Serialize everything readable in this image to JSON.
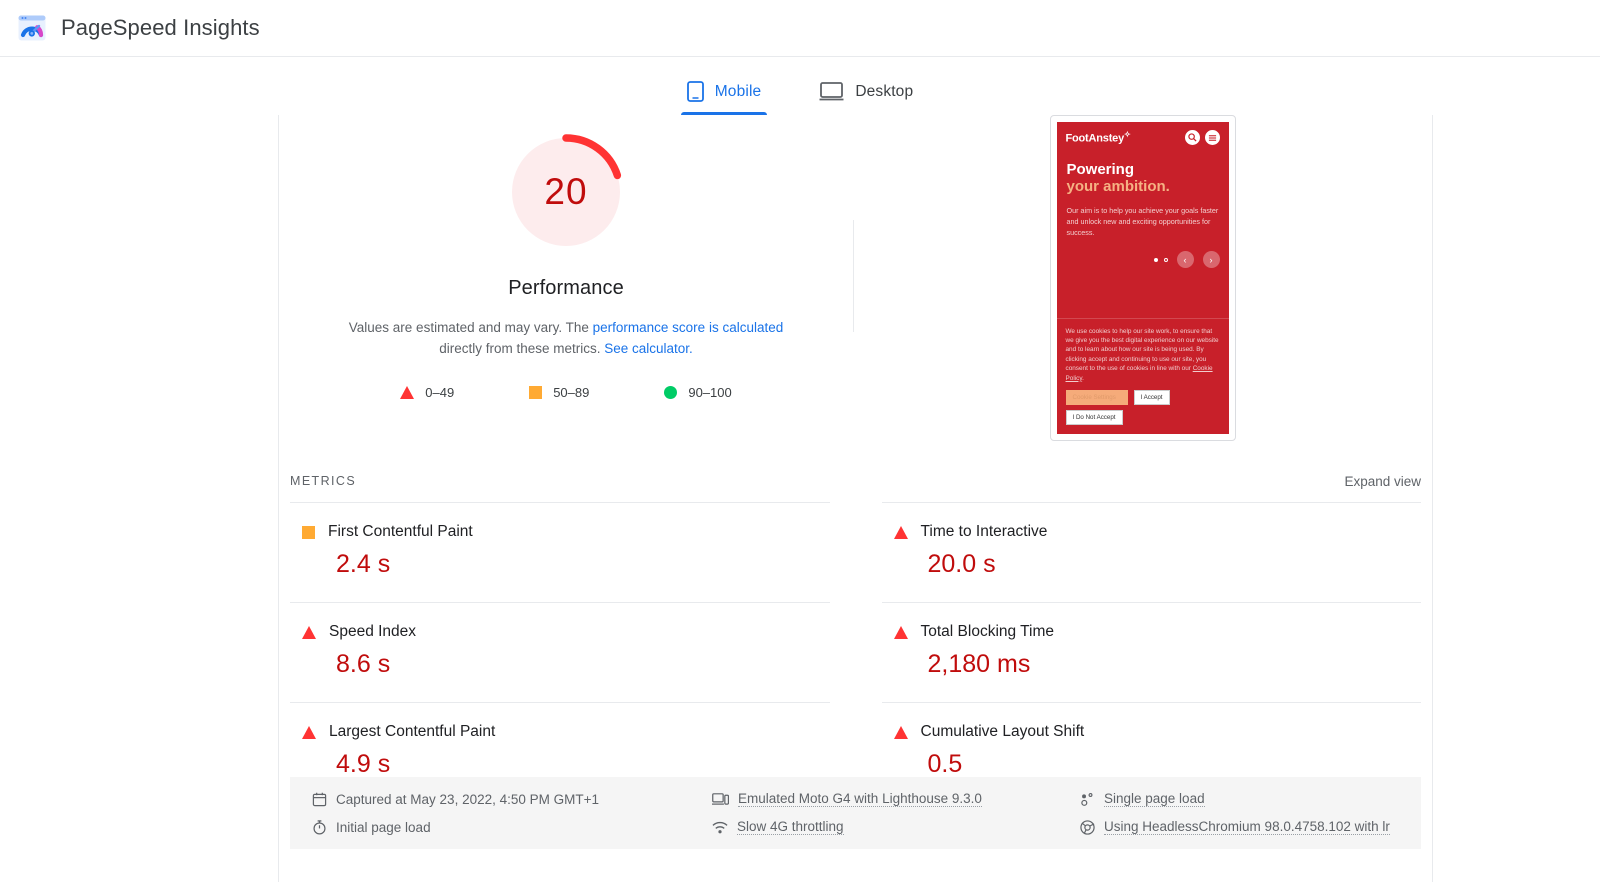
{
  "header": {
    "title": "PageSpeed Insights",
    "logo_icon": "pagespeed-logo-icon"
  },
  "tabs": [
    {
      "label": "Mobile",
      "icon": "mobile-phone-icon",
      "active": true
    },
    {
      "label": "Desktop",
      "icon": "desktop-monitor-icon",
      "active": false
    }
  ],
  "summary": {
    "score": "20",
    "score_color": "#c00c0c",
    "score_track_color": "#fdeced",
    "score_percent": 20,
    "category_title": "Performance",
    "description_part1": "Values are estimated and may vary. The ",
    "description_link1": "performance score is calculated",
    "description_part2": " directly from these metrics. ",
    "description_link2": "See calculator.",
    "legend": [
      {
        "icon": "red-triangle-icon",
        "label": "0–49",
        "color": "#ff3333"
      },
      {
        "icon": "orange-square-icon",
        "label": "50–89",
        "color": "#ffaa33"
      },
      {
        "icon": "green-circle-icon",
        "label": "90–100",
        "color": "#00cc66"
      }
    ]
  },
  "screenshot": {
    "brand": "FootAnstey",
    "brand_mark": "✧",
    "search_icon": "search-icon",
    "menu_icon": "hamburger-menu-icon",
    "heading_line1": "Powering",
    "heading_line2": "your ambition.",
    "body": "Our aim is to help you achieve your goals faster and unlock new and exciting opportunities for success.",
    "prev_arrow": "‹",
    "next_arrow": "›",
    "cookie_text_before_link": "We use cookies to help our site work, to ensure that we give you the best digital experience on our website and to learn about how our site is being used. By clicking accept and continuing to use our site, you consent to the use of cookies in line with our ",
    "cookie_link": "Cookie Policy",
    "cookie_text_after_link": ".",
    "buttons": {
      "settings": "Cookie Settings",
      "accept": "I Accept",
      "decline": "I Do Not Accept"
    }
  },
  "metrics_section": {
    "label": "METRICS",
    "expand_label": "Expand view",
    "items": [
      {
        "name": "First Contentful Paint",
        "value": "2.4 s",
        "status": "average",
        "icon": "orange-square-icon"
      },
      {
        "name": "Time to Interactive",
        "value": "20.0 s",
        "status": "poor",
        "icon": "red-triangle-icon"
      },
      {
        "name": "Speed Index",
        "value": "8.6 s",
        "status": "poor",
        "icon": "red-triangle-icon"
      },
      {
        "name": "Total Blocking Time",
        "value": "2,180 ms",
        "status": "poor",
        "icon": "red-triangle-icon"
      },
      {
        "name": "Largest Contentful Paint",
        "value": "4.9 s",
        "status": "poor",
        "icon": "red-triangle-icon"
      },
      {
        "name": "Cumulative Layout Shift",
        "value": "0.5",
        "status": "poor",
        "icon": "red-triangle-icon"
      }
    ]
  },
  "environment": [
    {
      "icon": "calendar-icon",
      "text": "Captured at May 23, 2022, 4:50 PM GMT+1",
      "dotted": false
    },
    {
      "icon": "device-icon",
      "text": "Emulated Moto G4 with Lighthouse 9.3.0",
      "dotted": true
    },
    {
      "icon": "pageload-icon",
      "text": "Single page load",
      "dotted": true
    },
    {
      "icon": "stopwatch-icon",
      "text": "Initial page load",
      "dotted": false
    },
    {
      "icon": "network-icon",
      "text": "Slow 4G throttling",
      "dotted": true
    },
    {
      "icon": "chrome-icon",
      "text": "Using HeadlessChromium 98.0.4758.102 with lr",
      "dotted": true
    }
  ]
}
